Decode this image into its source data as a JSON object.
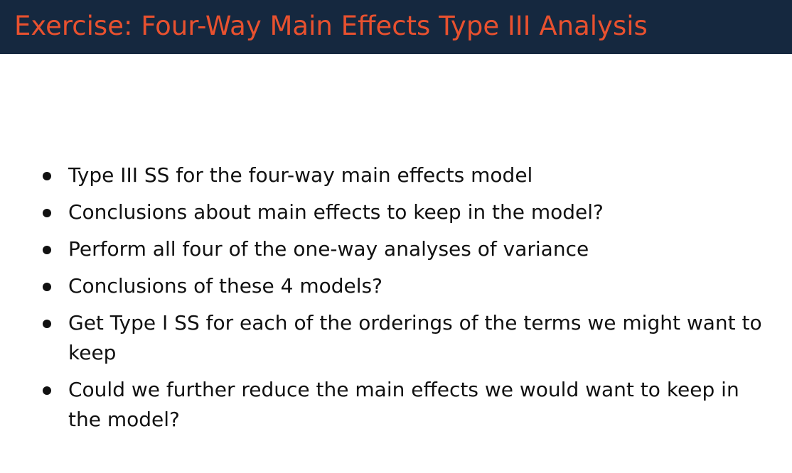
{
  "slide": {
    "title": "Exercise: Four-Way Main Effects Type III Analysis",
    "bullets": [
      "Type III SS for the four-way main effects model",
      "Conclusions about main effects to keep in the model?",
      "Perform all four of the one-way analyses of variance",
      "Conclusions of these 4 models?",
      "Get Type I SS for each of the orderings of the terms we might want to keep",
      "Could we further reduce the main effects we would want to keep in the model?"
    ]
  },
  "colors": {
    "title_bar": "#15283f",
    "title_text": "#e8512f",
    "body_text": "#111111"
  }
}
